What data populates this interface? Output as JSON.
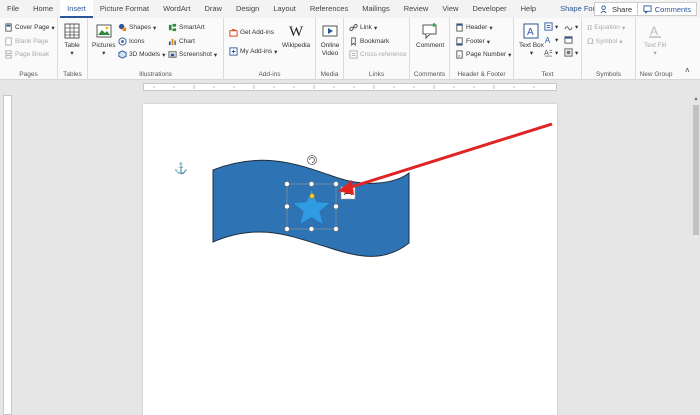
{
  "tabs": [
    "File",
    "Home",
    "Insert",
    "Picture Format",
    "WordArt",
    "Draw",
    "Design",
    "Layout",
    "References",
    "Mailings",
    "Review",
    "View",
    "Developer",
    "Help"
  ],
  "active_tab": "Insert",
  "contextual_tab": "Shape Format",
  "share_label": "Share",
  "comments_label": "Comments",
  "ribbon": {
    "pages": {
      "label": "Pages",
      "cover": "Cover Page",
      "blank": "Blank Page",
      "break": "Page Break"
    },
    "tables": {
      "label": "Tables",
      "table": "Table"
    },
    "illustrations": {
      "label": "Illustrations",
      "pictures": "Pictures",
      "shapes": "Shapes",
      "icons": "Icons",
      "models": "3D Models",
      "smartart": "SmartArt",
      "chart": "Chart",
      "screenshot": "Screenshot"
    },
    "addins": {
      "label": "Add-ins",
      "get": "Get Add-ins",
      "my": "My Add-ins",
      "wiki": "Wikipedia"
    },
    "media": {
      "label": "Media",
      "video": "Online Video"
    },
    "links": {
      "label": "Links",
      "link": "Link",
      "bookmark": "Bookmark",
      "cross": "Cross-reference"
    },
    "comments": {
      "label": "Comments",
      "comment": "Comment"
    },
    "headerfooter": {
      "label": "Header & Footer",
      "header": "Header",
      "footer": "Footer",
      "pagenum": "Page Number"
    },
    "text": {
      "label": "Text",
      "textbox": "Text Box"
    },
    "symbols": {
      "label": "Symbols",
      "equation": "Equation",
      "symbol": "Symbol"
    },
    "newgroup": {
      "label": "New Group",
      "textfill": "Text Fill"
    }
  },
  "colors": {
    "accent": "#2b579a",
    "wave_fill": "#2e74b5",
    "star_fill": "#2e9be3",
    "arrow": "#e02424"
  }
}
